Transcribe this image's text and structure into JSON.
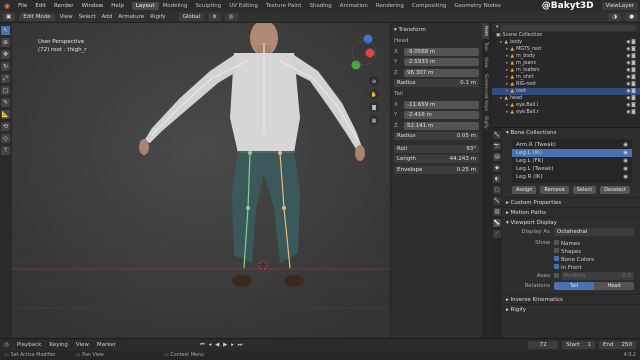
{
  "topbar": {
    "menus": [
      "File",
      "Edit",
      "Render",
      "Window",
      "Help"
    ],
    "workspaces": [
      "Layout",
      "Modeling",
      "Sculpting",
      "UV Editing",
      "Texture Paint",
      "Shading",
      "Animation",
      "Rendering",
      "Compositing",
      "Geometry Nodes"
    ],
    "active_workspace": "Layout",
    "scene_label": "Scene",
    "viewlayer_label": "ViewLayer"
  },
  "header2": {
    "mode": "Edit Mode",
    "menus": [
      "View",
      "Select",
      "Add",
      "Armature",
      "Rigify"
    ],
    "orientation": "Global"
  },
  "viewport": {
    "title": "User Perspective",
    "subtitle": "(72) root : thigh_r"
  },
  "watermark": "@Bakyt3D",
  "transform": {
    "title": "Transform",
    "head_label": "Head",
    "head": [
      {
        "k": "X",
        "v": "-9.0568 m"
      },
      {
        "k": "Y",
        "v": "-2.5933 m"
      },
      {
        "k": "Z",
        "v": "96.307 m"
      }
    ],
    "head_radius": {
      "k": "Radius",
      "v": "0.1 m"
    },
    "tail_label": "Tail",
    "tail": [
      {
        "k": "X",
        "v": "-11.659 m"
      },
      {
        "k": "Y",
        "v": "-2.416 m"
      },
      {
        "k": "Z",
        "v": "52.141 m"
      }
    ],
    "tail_radius": {
      "k": "Radius",
      "v": "0.05 m"
    },
    "extra": [
      {
        "k": "Roll",
        "v": "93°"
      },
      {
        "k": "Length",
        "v": "44.243 m"
      },
      {
        "k": "Envelope",
        "v": "0.25 m"
      }
    ]
  },
  "vtabs": [
    "Item",
    "Tool",
    "View",
    "Screencast Keys",
    "Rigify"
  ],
  "outliner": {
    "title": "Scene Collection",
    "rows": [
      {
        "name": "body",
        "indent": 8,
        "sel": false
      },
      {
        "name": "MGTS_rest",
        "indent": 14,
        "sel": false
      },
      {
        "name": "m_body",
        "indent": 14,
        "sel": false
      },
      {
        "name": "m_jeans",
        "indent": 14,
        "sel": false
      },
      {
        "name": "m_loafers",
        "indent": 14,
        "sel": false
      },
      {
        "name": "m_shirt",
        "indent": 14,
        "sel": false
      },
      {
        "name": "RIG-root",
        "indent": 14,
        "sel": false
      },
      {
        "name": "root",
        "indent": 14,
        "sel": true
      },
      {
        "name": "head",
        "indent": 8,
        "sel": false
      },
      {
        "name": "eye.Ball.l",
        "indent": 14,
        "sel": false
      },
      {
        "name": "eye.Ball.r",
        "indent": 14,
        "sel": false
      }
    ]
  },
  "props": {
    "bone_collections_title": "Bone Collections",
    "collections": [
      "Arm.R (Tweak)",
      "Leg.L (IK)",
      "Leg.L (FK)",
      "Leg.L (Tweak)",
      "Leg.R (IK)"
    ],
    "active_collection": "Leg.L (IK)",
    "buttons": [
      "Assign",
      "Remove",
      "Select",
      "Deselect"
    ],
    "custom_properties": "Custom Properties",
    "motion_paths": "Motion Paths",
    "viewport_display": "Viewport Display",
    "display_as_label": "Display As",
    "display_as_value": "Octahedral",
    "show_label": "Show",
    "show_options": [
      {
        "label": "Names",
        "checked": false
      },
      {
        "label": "Shapes",
        "checked": false
      },
      {
        "label": "Bone Colors",
        "checked": true
      },
      {
        "label": "In Front",
        "checked": true
      }
    ],
    "axes_label": "Axes",
    "axes_position_label": "Position",
    "axes_position_value": "0.0",
    "relations_label": "Relations",
    "relations_options": [
      "Tail",
      "Head"
    ],
    "inverse_kinematics": "Inverse Kinematics",
    "rigify": "Rigify"
  },
  "timeline": {
    "items": [
      "Playback",
      "Keying",
      "View",
      "Marker"
    ],
    "current_frame": "72",
    "start_label": "Start",
    "start_value": "1",
    "end_label": "End",
    "end_value": "250"
  },
  "statusbar": {
    "items": [
      "Set Active Modifier",
      "Pan View",
      "Context Menu"
    ],
    "version": "4.0.2"
  },
  "colors": {
    "accent": "#4772b3",
    "bone_green": "#7fd87f",
    "bone_white": "#e8e8e8"
  }
}
